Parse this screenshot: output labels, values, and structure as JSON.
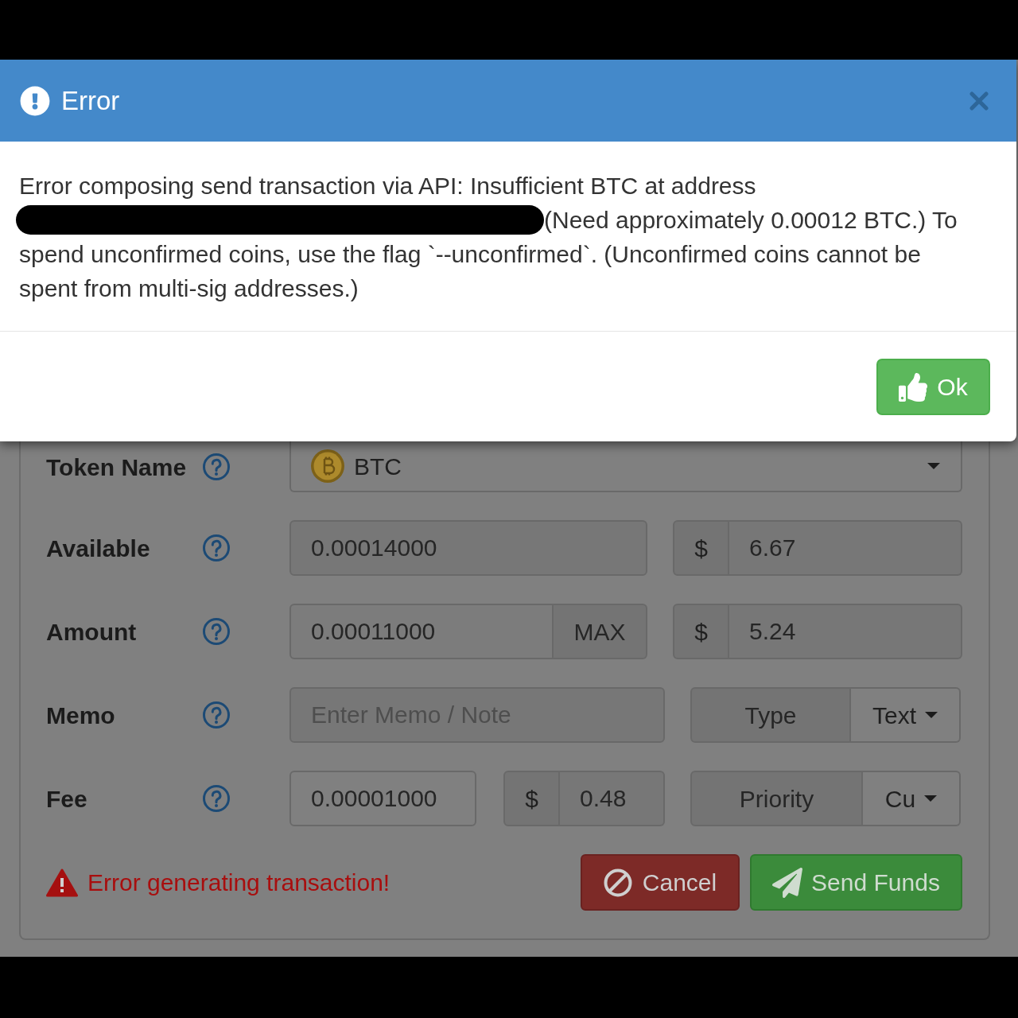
{
  "dialog": {
    "title": "Error",
    "message": {
      "lead": "Error composing send transaction via API: Insufficient BTC at address",
      "beside_redaction": "(Need approximately 0.00012 BTC.) To",
      "rest": "spend unconfirmed coins, use the flag `--unconfirmed`. (Unconfirmed coins cannot be spent from multi-sig addresses.)"
    },
    "ok_button": "Ok"
  },
  "form": {
    "rows": [
      {
        "kind": "token",
        "label": "Token Name",
        "value": "BTC"
      },
      {
        "kind": "available",
        "label": "Available",
        "value": "0.00014000",
        "currency_symbol": "$",
        "fiat_value": "6.67"
      },
      {
        "kind": "amount",
        "label": "Amount",
        "value": "0.00011000",
        "max_button": "MAX",
        "currency_symbol": "$",
        "fiat_value": "5.24"
      },
      {
        "kind": "memo",
        "label": "Memo",
        "placeholder": "Enter Memo / Note",
        "type_label": "Type",
        "type_value": "Text"
      },
      {
        "kind": "fee",
        "label": "Fee",
        "value": "0.00001000",
        "currency_symbol": "$",
        "fiat_value": "0.48",
        "priority_label": "Priority",
        "priority_value": "Cu"
      }
    ],
    "status": "Error generating transaction!",
    "buttons": [
      {
        "kind": "cancel",
        "label": "Cancel"
      },
      {
        "kind": "send",
        "label": "Send Funds"
      }
    ]
  }
}
